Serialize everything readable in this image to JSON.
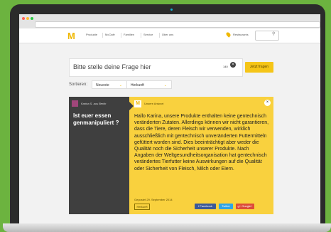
{
  "nav": {
    "logo": "M",
    "items": [
      "Produkte",
      "McCafé",
      "Familien",
      "Service",
      "Über uns"
    ],
    "restaurants": "Restaurants"
  },
  "ask": {
    "placeholder": "Bitte stelle deine Frage hier",
    "counter": "140",
    "clear": "×",
    "button": "Jetzt fragen"
  },
  "sort": {
    "label": "Sortieren:",
    "option1": "Neueste",
    "option2": "Herkunft"
  },
  "question": {
    "user": "Karina S. aus Berlin",
    "text": "Ist euer essen genmanipuliert ?"
  },
  "answer": {
    "author": "Unsere Antwort",
    "close": "×",
    "text": "Hallo Karina, unsere Produkte enthalten keine gentechnisch veränderten Zutaten. Allerdings können wir nicht garantieren, dass die Tiere, deren Fleisch wir verwenden, wirklich ausschließlich mit gentechnisch unveränderten Futtermitteln gefüttert worden sind. Dies beeinträchtigt aber weder die Qualität noch die Sicherheit unserer Produkte. Nach Angaben der Weltgesundheitsorganisation hat gentechnisch verändertes Tierfutter keine Auswirkungen auf die Qualität oder Sicherheit von Fleisch, Milch oder Eiern.",
    "posted": "Gepostet 29. September 2014",
    "origin": "Herkunft",
    "share": {
      "facebook": "f  Facebook",
      "twitter": "Twitter",
      "google": "g+ Google+"
    }
  },
  "colors": {
    "brand_yellow": "#f9d13e",
    "button_yellow": "#f5c518",
    "background_green": "#6cb33f",
    "question_bg": "#3f3f3f",
    "facebook": "#3b5998",
    "twitter": "#2fa4e6",
    "google": "#dd4b39"
  }
}
